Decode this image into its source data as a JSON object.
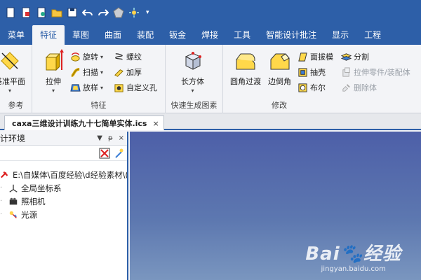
{
  "tabs": [
    "菜单",
    "特征",
    "草图",
    "曲面",
    "装配",
    "钣金",
    "焊接",
    "工具",
    "智能设计批注",
    "显示",
    "工程"
  ],
  "active_tab_index": 1,
  "ribbon": {
    "ref_group": {
      "label": "参考",
      "plane_btn": "基准平面"
    },
    "feature_group": {
      "label": "特征",
      "extrude": "拉伸",
      "revolve": "旋转",
      "sweep": "扫描",
      "loft": "放样",
      "helix": "螺纹",
      "thicken": "加厚",
      "custom_hole": "自定义孔"
    },
    "quick_group": {
      "label": "快速生成图素",
      "box": "长方体"
    },
    "modify_group": {
      "label": "修改",
      "fillet": "圆角过渡",
      "chamfer": "边倒角",
      "draft": "面拔模",
      "shell": "抽壳",
      "boolean": "布尔",
      "split": "分割",
      "extrude_part": "拉伸零件/装配体",
      "delete_body": "删除体"
    }
  },
  "document": {
    "tab_title": "caxa三维设计训练九十七简单实体.ics",
    "close": "×"
  },
  "panel": {
    "title": "计环境",
    "controls": [
      "▼",
      "ᵽ",
      "×"
    ],
    "tree": [
      {
        "label": "E:\\自媒体\\百度经验\\d经验素材\\(",
        "icon": "path-icon"
      },
      {
        "label": "全局坐标系",
        "icon": "axis-icon"
      },
      {
        "label": "照相机",
        "icon": "camera-icon"
      },
      {
        "label": "光源",
        "icon": "light-icon"
      }
    ]
  },
  "watermark": {
    "logo": "Bai🐾经验",
    "url": "jingyan.baidu.com"
  },
  "colors": {
    "accent": "#2d5fa8",
    "viewport_top": "#4d5fa8",
    "viewport_bottom": "#7a96bf"
  }
}
